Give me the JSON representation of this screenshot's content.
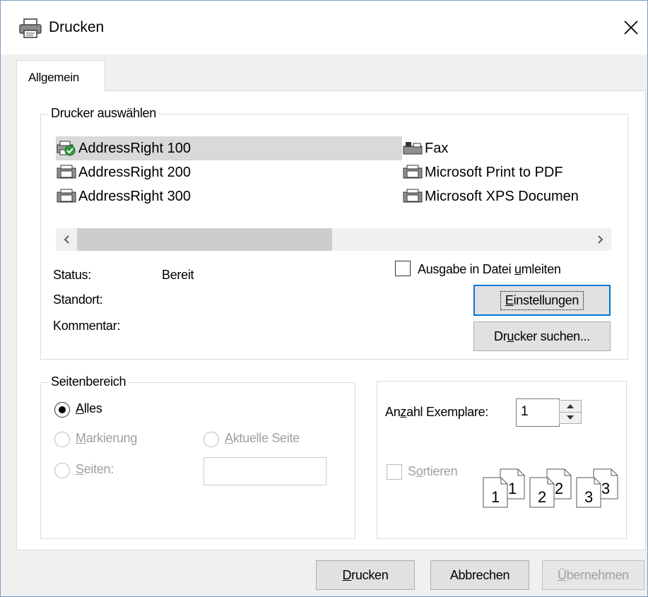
{
  "window": {
    "title": "Drucken",
    "close_glyph": "✕"
  },
  "tabs": [
    {
      "label": "Allgemein"
    }
  ],
  "printer_group": {
    "label": "Drucker auswählen",
    "printers": [
      {
        "name": "AddressRight 100",
        "icon": "printer-default-icon"
      },
      {
        "name": "AddressRight 200",
        "icon": "printer-icon"
      },
      {
        "name": "AddressRight 300",
        "icon": "printer-icon"
      },
      {
        "name": "Fax",
        "icon": "fax-icon"
      },
      {
        "name": "Microsoft Print to PDF",
        "icon": "printer-icon"
      },
      {
        "name": "Microsoft XPS Documen",
        "icon": "printer-icon"
      }
    ],
    "selected_index": 0,
    "status_label": "Status:",
    "status_value": "Bereit",
    "location_label": "Standort:",
    "comment_label": "Kommentar:",
    "print_to_file": {
      "pre": "Ausgabe in Datei ",
      "key": "u",
      "post": "mleiten",
      "checked": false
    },
    "settings_button": {
      "pre": "",
      "key": "E",
      "post": "instellungen"
    },
    "find_button": {
      "pre": "Dr",
      "key": "u",
      "post": "cker suchen..."
    }
  },
  "range_group": {
    "label": "Seitenbereich",
    "all": {
      "pre": "",
      "key": "A",
      "post": "lles",
      "selected": true
    },
    "selection": {
      "pre": "",
      "key": "M",
      "post": "arkierung",
      "enabled": false
    },
    "current": {
      "pre": "",
      "key": "A",
      "post": "ktuelle Seite",
      "enabled": false
    },
    "pages": {
      "pre": "",
      "key": "S",
      "post": "eiten:",
      "enabled": false,
      "value": ""
    }
  },
  "copies_group": {
    "copies_label": {
      "pre": "An",
      "key": "z",
      "post": "ahl Exemplare:"
    },
    "copies_value": "1",
    "collate": {
      "pre": "S",
      "key": "o",
      "post": "rtieren",
      "checked": false,
      "enabled": false
    },
    "collate_pages": [
      "1",
      "1",
      "2",
      "2",
      "3",
      "3"
    ]
  },
  "footer": {
    "print_button": {
      "pre": "",
      "key": "D",
      "post": "rucken"
    },
    "cancel_button": {
      "label": "Abbrechen"
    },
    "apply_button": {
      "pre": "",
      "key": "Ü",
      "post": "bernehmen",
      "enabled": false
    }
  }
}
